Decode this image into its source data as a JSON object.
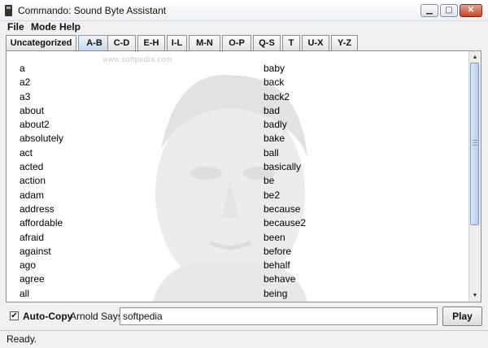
{
  "window": {
    "title": "Commando: Sound Byte Assistant",
    "controls": {
      "minimize": "▁",
      "maximize": "▢",
      "close": "✕"
    }
  },
  "menu": [
    "File",
    "Mode",
    "Help"
  ],
  "tabs": [
    {
      "label": "Uncategorized",
      "active": false
    },
    {
      "label": "A-B",
      "active": true
    },
    {
      "label": "C-D",
      "active": false
    },
    {
      "label": "E-H",
      "active": false
    },
    {
      "label": "I-L",
      "active": false
    },
    {
      "label": "M-N",
      "active": false
    },
    {
      "label": "O-P",
      "active": false
    },
    {
      "label": "Q-S",
      "active": false
    },
    {
      "label": "T",
      "active": false
    },
    {
      "label": "U-X",
      "active": false
    },
    {
      "label": "Y-Z",
      "active": false
    }
  ],
  "watermark": "www.softpedia.com",
  "words_left": [
    "a",
    "a2",
    "a3",
    "about",
    "about2",
    "absolutely",
    "act",
    "acted",
    "action",
    "adam",
    "address",
    "affordable",
    "afraid",
    "against",
    "ago",
    "agree",
    "all"
  ],
  "words_right": [
    "baby",
    "back",
    "back2",
    "bad",
    "badly",
    "bake",
    "ball",
    "basically",
    "be",
    "be2",
    "because",
    "because2",
    "been",
    "before",
    "behalf",
    "behave",
    "being"
  ],
  "scroll": {
    "position": 0.0
  },
  "bottom": {
    "auto_copy_label": "Auto-Copy",
    "auto_copy_checked": true,
    "arnold_label": "Arnold Says:",
    "arnold_value": "softpedia",
    "play_label": "Play"
  },
  "status": "Ready."
}
